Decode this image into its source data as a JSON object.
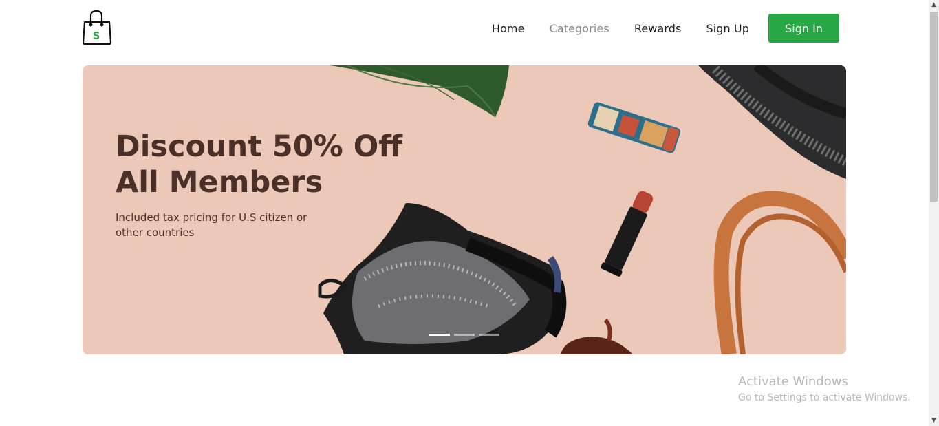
{
  "header": {
    "logo_letter": "S",
    "nav": [
      {
        "label": "Home"
      },
      {
        "label": "Categories"
      },
      {
        "label": "Rewards"
      },
      {
        "label": "Sign Up"
      }
    ],
    "signin_label": "Sign In"
  },
  "hero": {
    "title_line1": "Discount 50% Off",
    "title_line2": "All Members",
    "subtitle": "Included tax pricing for U.S citizen or other countries",
    "slides_total": 3,
    "active_slide": 1
  },
  "watermark": {
    "title": "Activate Windows",
    "subtitle": "Go to Settings to activate Windows."
  },
  "colors": {
    "accent": "#28a745",
    "hero_bg": "#ecc8b9",
    "title": "#4a3029",
    "nav_muted": "#8a8a8a"
  }
}
